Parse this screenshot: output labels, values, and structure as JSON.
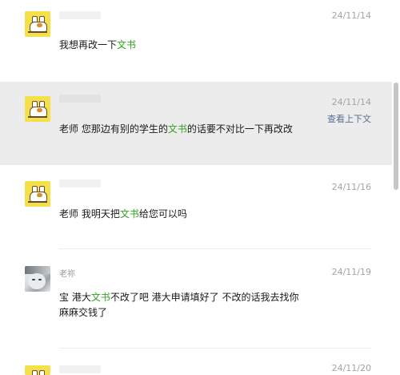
{
  "messages": [
    {
      "sender": "",
      "date": "24/11/14",
      "text_parts": [
        "我想再改一下",
        "文书",
        ""
      ]
    },
    {
      "sender": "",
      "date": "24/11/14",
      "context_link": "查看上下文",
      "text_parts": [
        "老师 您那边有别的学生的",
        "文书",
        "的话要不对比一下再改改"
      ]
    },
    {
      "sender": "",
      "date": "24/11/16",
      "text_parts": [
        "老师 我明天把",
        "文书",
        "给您可以吗"
      ]
    },
    {
      "sender": "老祢",
      "date": "24/11/19",
      "text_parts": [
        "宝 港大",
        "文书",
        "不改了吧 港大申请填好了 不改的话我去找你",
        "麻麻交钱了"
      ]
    },
    {
      "sender": "",
      "date": "24/11/20"
    }
  ],
  "colors": {
    "keyword_highlight": "#2fa51d",
    "context_link": "#5a6d92",
    "highlight_row_bg": "#ececec"
  },
  "icons": {
    "avatar_1": "cat-sticker-avatar",
    "avatar_4": "person-photo-avatar"
  }
}
